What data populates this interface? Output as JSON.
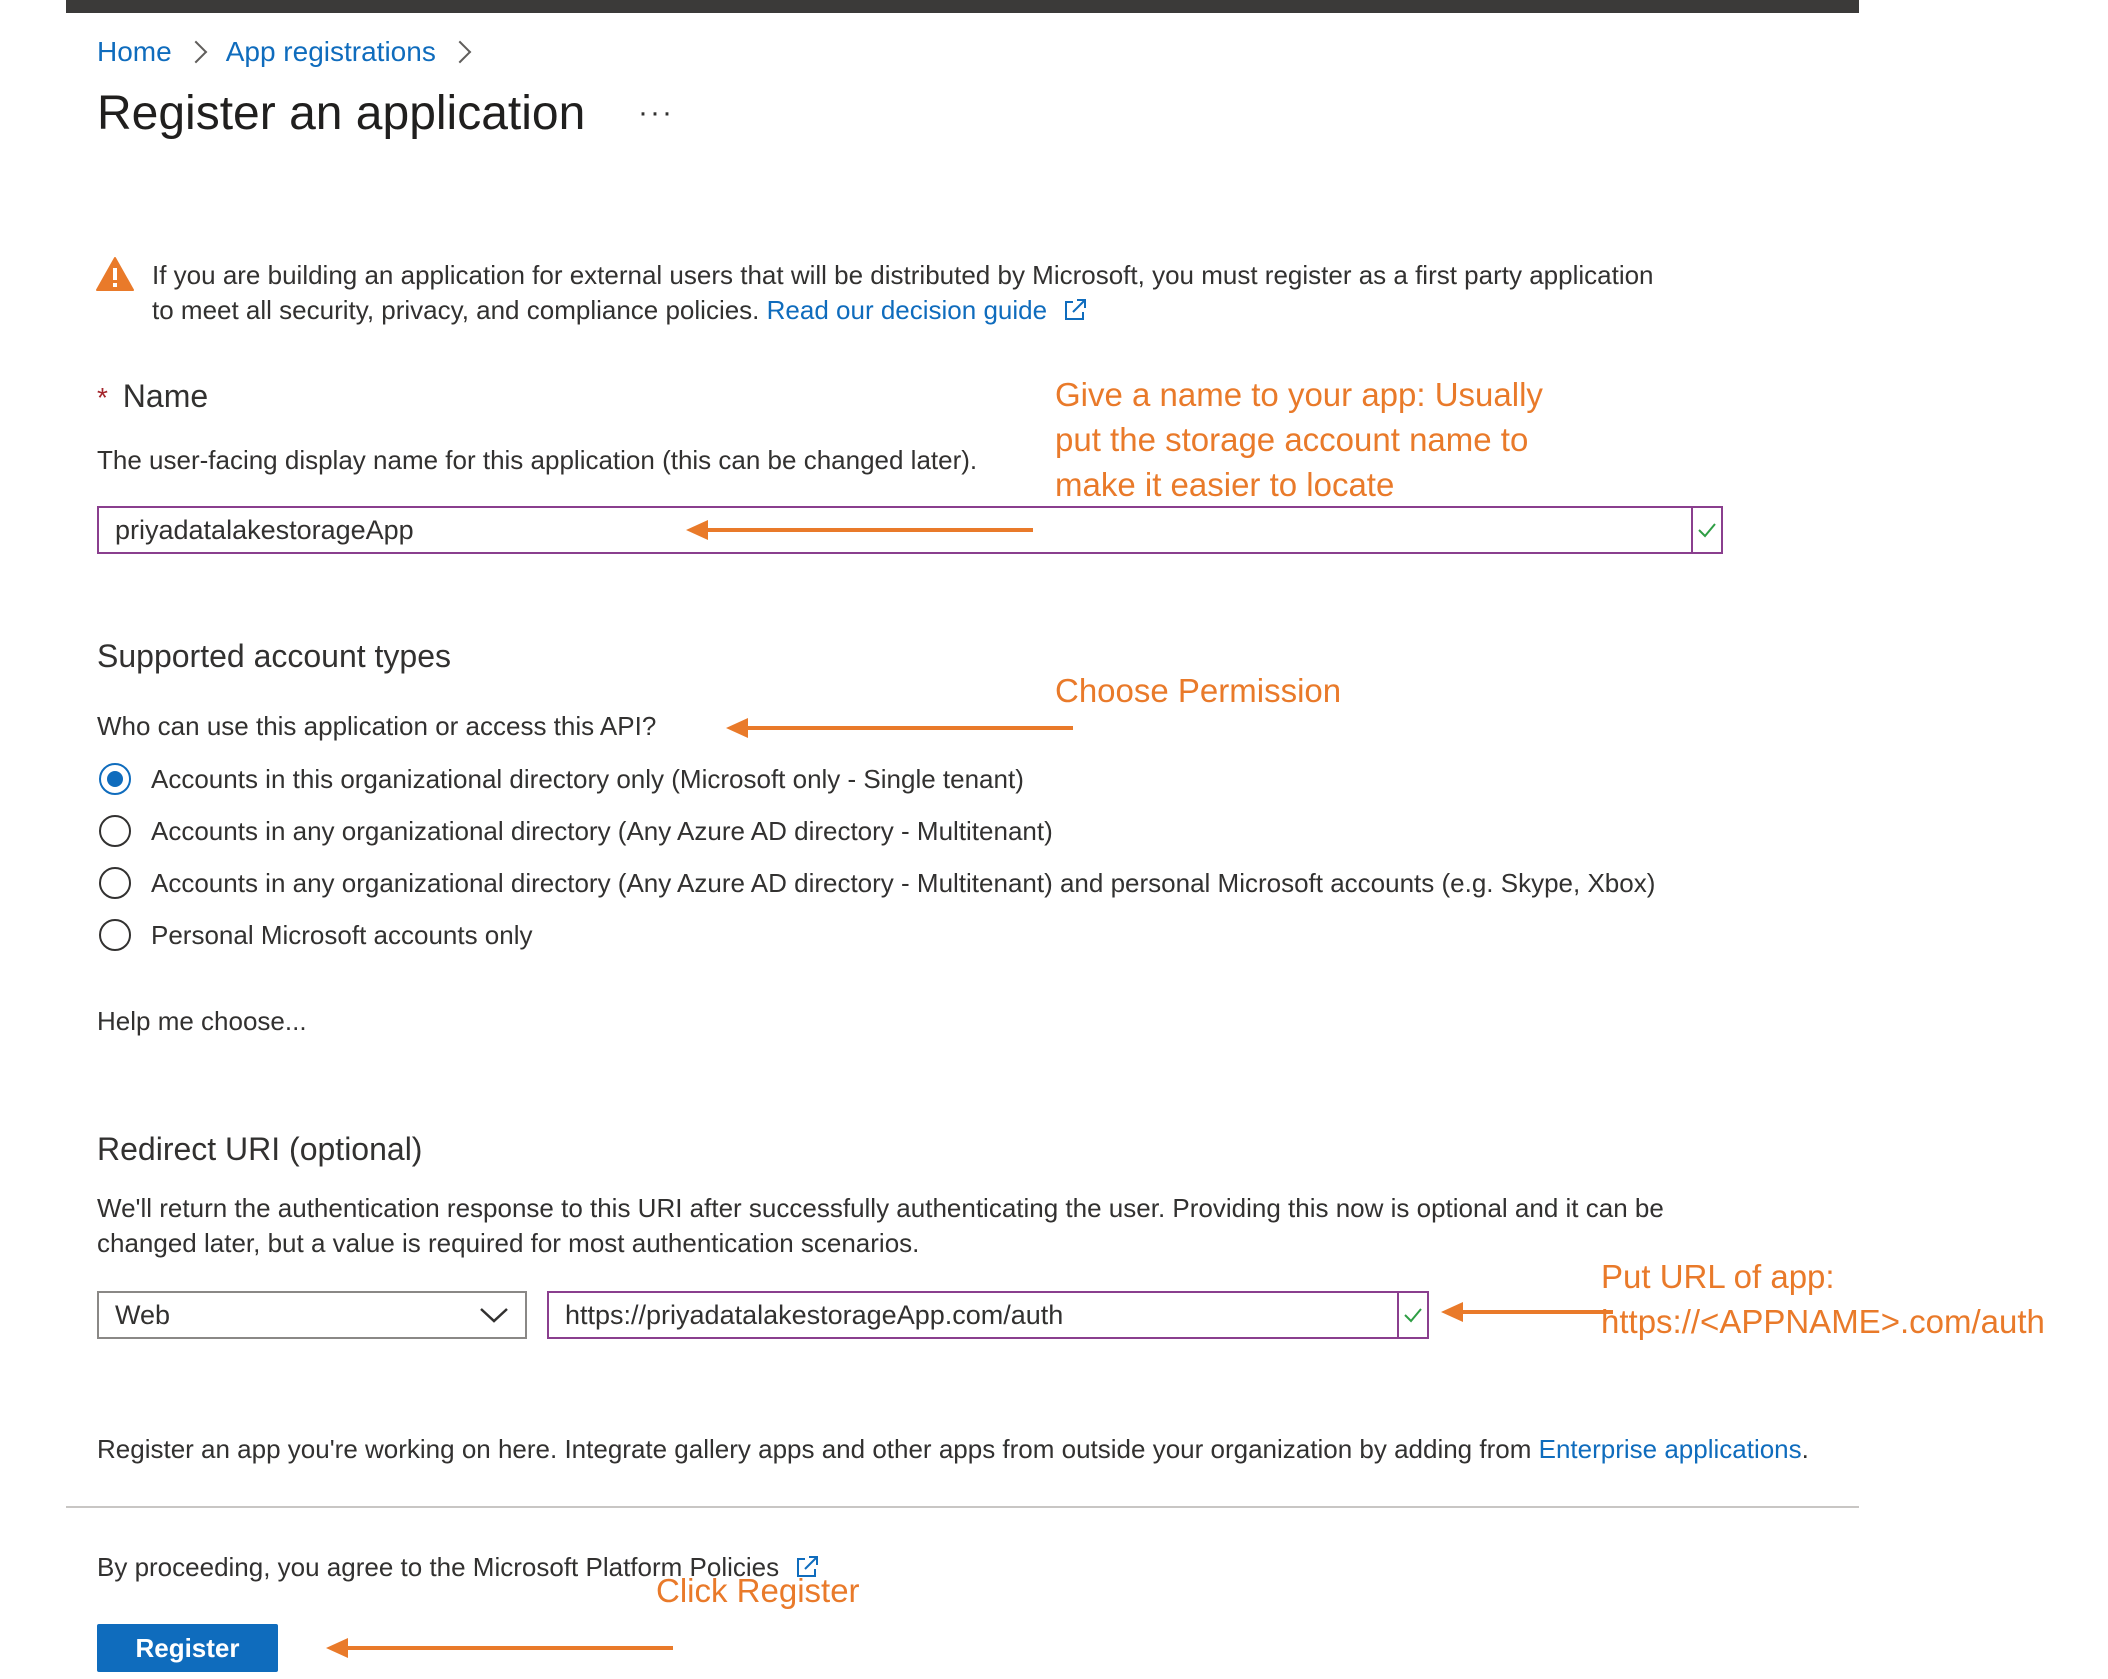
{
  "breadcrumb": {
    "home": "Home",
    "app_registrations": "App registrations"
  },
  "page": {
    "title": "Register an application",
    "more_label": "···"
  },
  "warning": {
    "text": "If you are building an application for external users that will be distributed by Microsoft, you must register as a first party application to meet all security, privacy, and compliance policies.",
    "link": "Read our decision guide"
  },
  "name_section": {
    "required_mark": "*",
    "label": "Name",
    "description": "The user-facing display name for this application (this can be changed later).",
    "value": "priyadatalakestorageApp"
  },
  "account_types": {
    "title": "Supported account types",
    "question": "Who can use this application or access this API?",
    "options": [
      "Accounts in this organizational directory only (Microsoft only - Single tenant)",
      "Accounts in any organizational directory (Any Azure AD directory - Multitenant)",
      "Accounts in any organizational directory (Any Azure AD directory - Multitenant) and personal Microsoft accounts (e.g. Skype, Xbox)",
      "Personal Microsoft accounts only"
    ],
    "selected_index": 0,
    "help_link": "Help me choose..."
  },
  "redirect": {
    "title": "Redirect URI (optional)",
    "description_line1": "We'll return the authentication response to this URI after successfully authenticating the user. Providing this now is optional and it can be",
    "description_line2": "changed later, but a value is required for most authentication scenarios.",
    "platform": "Web",
    "uri": "https://priyadatalakestorageApp.com/auth"
  },
  "footer": {
    "register_note": "Register an app you're working on here. Integrate gallery apps and other apps from outside your organization by adding from",
    "enterprise_link": "Enterprise applications",
    "policies_link": "By proceeding, you agree to the Microsoft Platform Policies",
    "register_button": "Register"
  },
  "annotations": {
    "name_line1": "Give a name to your app: Usually",
    "name_line2": "put the storage account name to",
    "name_line3": "make it easier to locate",
    "permission": "Choose Permission",
    "url_line1": "Put URL of app:",
    "url_line2": "https://<APPNAME>.com/auth",
    "register": "Click Register"
  },
  "colors": {
    "accent": "#0f6cbd",
    "annotation": "#e97a2a",
    "warning": "#e97a2a",
    "input_border": "#8a3f8e",
    "check": "#2e9e44"
  },
  "icons": [
    "warning-icon",
    "external-link-icon",
    "checkmark-icon",
    "chevron-down-icon",
    "arrow-left-icon"
  ]
}
